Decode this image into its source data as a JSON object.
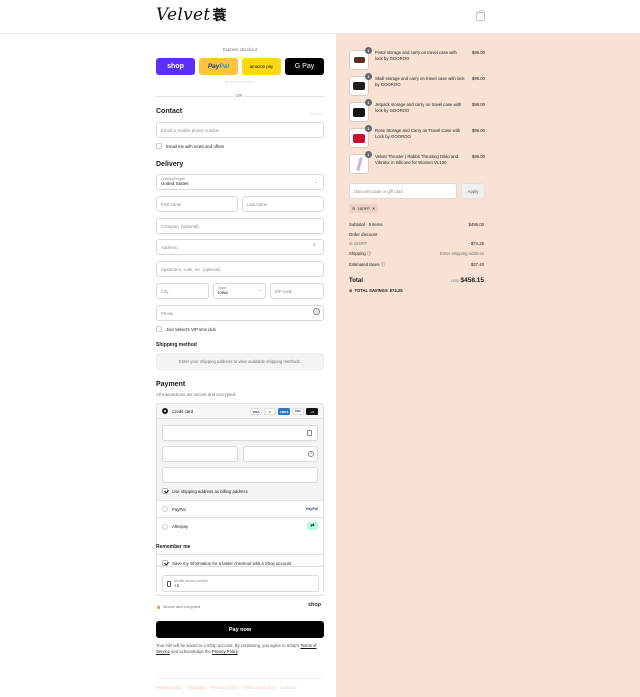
{
  "brand": {
    "logo_text": "Velvet",
    "logo_mark": "蓑"
  },
  "express": {
    "title": "Express checkout",
    "buttons": [
      {
        "label": "shop",
        "name": "shop-pay"
      },
      {
        "label_a": "Pay",
        "label_b": "Pal",
        "name": "paypal"
      },
      {
        "label": "amazon pay",
        "name": "amazon-pay"
      },
      {
        "label": "G Pay",
        "name": "google-pay"
      }
    ],
    "faint_text": "Show more options",
    "or": "OR"
  },
  "contact": {
    "heading": "Contact",
    "login": "Log in",
    "email_placeholder": "Email or mobile phone number",
    "news_label": "Email me with news and offers"
  },
  "delivery": {
    "heading": "Delivery",
    "country_label": "Country/Region",
    "country_value": "United States",
    "first_name": "First name",
    "last_name": "Last name",
    "company": "Company (optional)",
    "address": "Address",
    "apartment": "Apartment, suite, etc. (optional)",
    "city": "City",
    "state_label": "State",
    "state_value": "Iowa",
    "zip": "ZIP code",
    "phone": "Phone",
    "sms_label": "Join Velvet's VIP sms club"
  },
  "shipping_method": {
    "heading": "Shipping method",
    "notice": "Enter your shipping address to view available shipping methods."
  },
  "payment": {
    "heading": "Payment",
    "subtitle": "All transactions are secure and encrypted.",
    "credit_card": "Credit card",
    "card_brands": [
      "VISA",
      "MC",
      "AMEX",
      "DISC",
      "+4"
    ],
    "billing_label": "Use shipping address as billing address",
    "paypal": "PayPal",
    "paypal_logo": "PayPal",
    "afterpay": "Afterpay"
  },
  "remember": {
    "heading": "Remember me",
    "save_label": "Save my information for a faster checkout with a Shop account",
    "mobile_label": "Mobile phone number",
    "mobile_value": "+1",
    "secure": "Secure and encrypted",
    "shop_logo": "shop"
  },
  "pay_now": "Pay now",
  "legal": {
    "text": "Your info will be saved to a Shop account. By continuing, you agree to Shop's",
    "terms": "Terms of Service",
    "and": "and acknowledge the",
    "privacy": "Privacy Policy",
    "end": "."
  },
  "footer_links": [
    "Refund policy",
    "Shipping",
    "Privacy policy",
    "Terms of service",
    "Contact"
  ],
  "order": {
    "items": [
      {
        "qty": "1",
        "name": "Pistol storage and carry on travel case with lock by GOOROO",
        "price": "$99.00"
      },
      {
        "qty": "1",
        "name": "Skull storage and carry on travel case with lock by GOOROO",
        "price": "$99.00"
      },
      {
        "qty": "1",
        "name": "Jetpack storage and carry on travel case with lock by GOOROO",
        "price": "$99.00"
      },
      {
        "qty": "1",
        "name": "Rose Storage and Carry on Travel Case with Lock by GOOROO",
        "price": "$99.00"
      },
      {
        "qty": "1",
        "name": "Velvet Thruster | Rabbit Thrusting Dildo and Vibrator in Silicone for Women VL100",
        "price": "$99.00"
      }
    ],
    "discount_placeholder": "Discount code or gift card",
    "apply": "Apply",
    "code_tag": "15OFF",
    "subtotal_label": "Subtotal · 5 items",
    "subtotal_value": "$495.00",
    "order_discount_label": "Order discount",
    "code_label": "15OFF",
    "discount_value": "- $74.25",
    "shipping_label": "Shipping",
    "shipping_value": "Enter shipping address",
    "taxes_label": "Estimated taxes",
    "taxes_value": "$37.40",
    "total_label": "Total",
    "currency": "USD",
    "total_value": "$458.15",
    "savings_label": "TOTAL SAVINGS",
    "savings_value": "$74.25"
  },
  "colors": {
    "shop": "#5a31f4",
    "paypal": "#ffc439",
    "amazon": "#ffd814",
    "summary_bg": "#f8e2d6",
    "accent_link": "#f0c9b5"
  }
}
